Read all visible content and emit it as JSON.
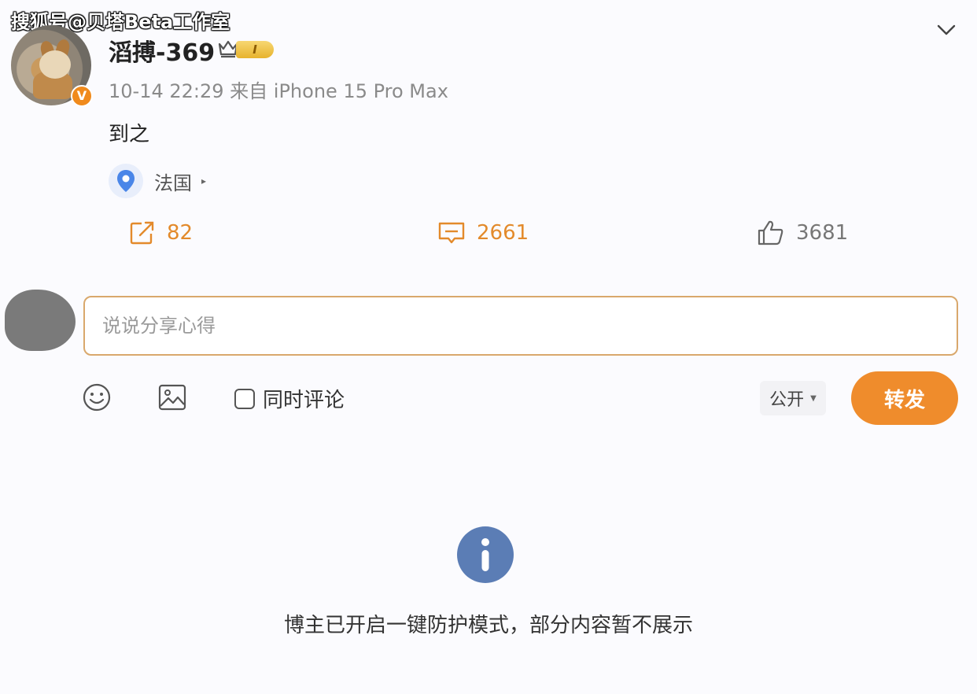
{
  "watermark": "搜狐号@贝塔Beta工作室",
  "post": {
    "username": "滔搏-369",
    "level_badge": "I",
    "verified_mark": "V",
    "meta": "10-14 22:29 来自 iPhone 15 Pro Max",
    "content": "到之",
    "location": "法国",
    "stats": {
      "shares": "82",
      "comments": "2661",
      "likes": "3681"
    }
  },
  "composer": {
    "placeholder": "说说分享心得",
    "also_comment_label": "同时评论",
    "visibility_label": "公开",
    "submit_label": "转发"
  },
  "notice": {
    "text": "博主已开启一键防护模式，部分内容暂不展示"
  },
  "icons": {
    "share": "share-icon",
    "comment": "comment-icon",
    "like": "thumbs-up-icon",
    "emoji": "emoji-icon",
    "image": "image-icon",
    "info": "info-icon",
    "location": "location-pin-icon",
    "expand": "chevron-down-icon"
  },
  "colors": {
    "accent": "#ef8c2c",
    "verified": "#f08a1c",
    "info": "#5b7db5",
    "location_pin": "#4a86e8"
  }
}
